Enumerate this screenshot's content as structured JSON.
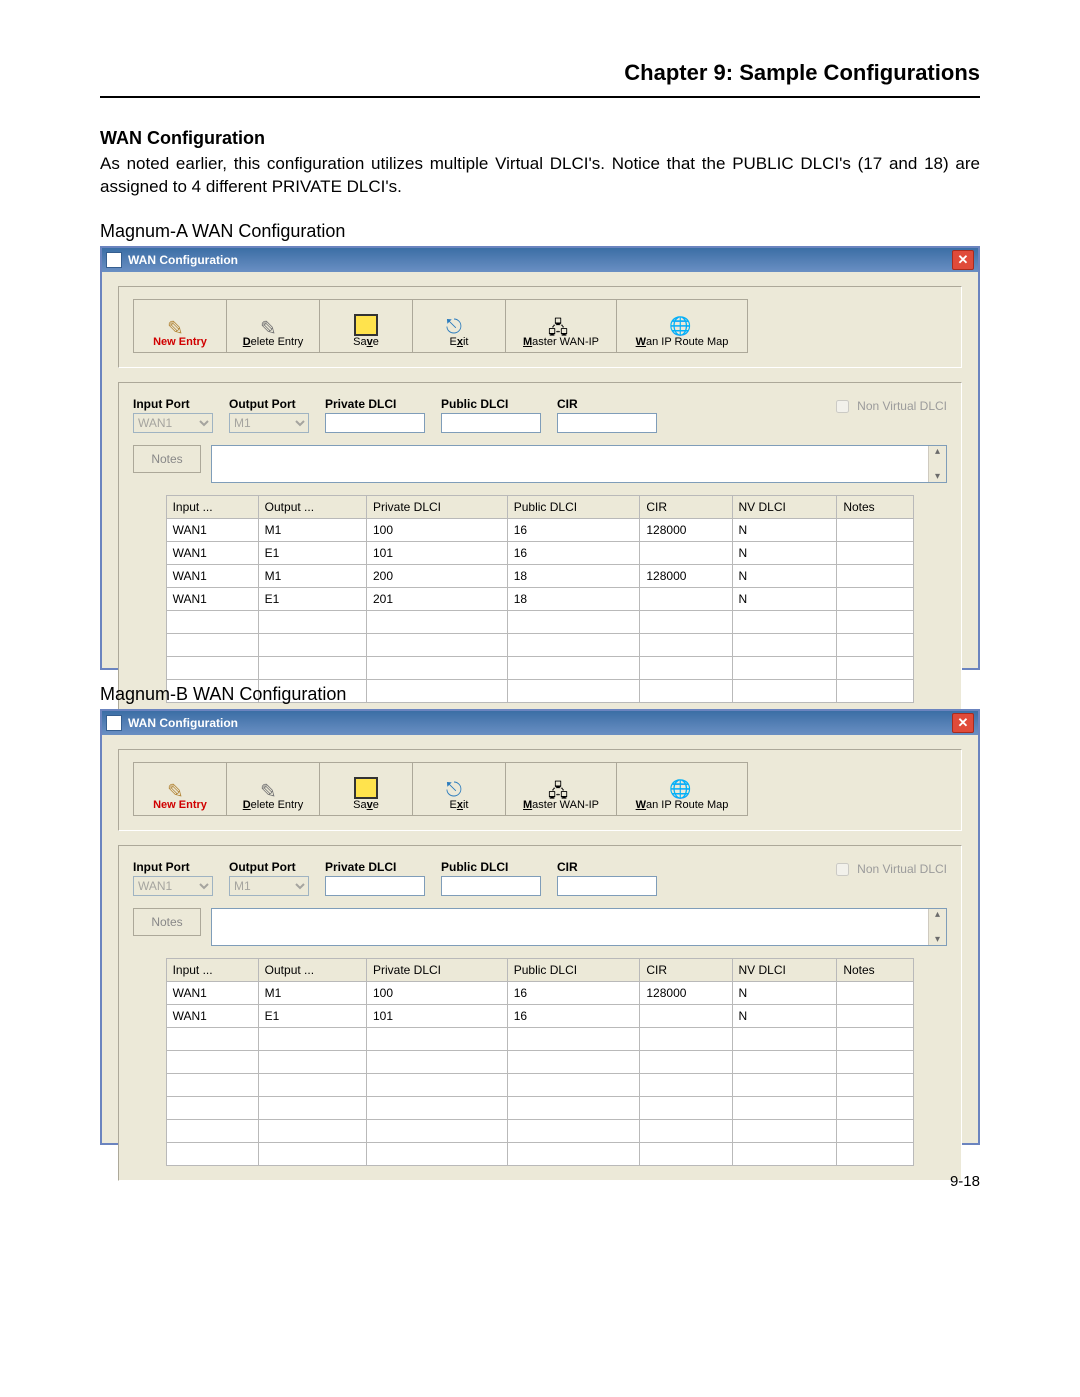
{
  "doc": {
    "chapter": "Chapter 9: Sample Configurations",
    "section": "WAN Configuration",
    "paragraph": "As noted earlier, this configuration utilizes multiple Virtual DLCI's.  Notice that the PUBLIC DLCI's (17 and 18) are assigned to 4 different PRIVATE DLCI's.",
    "labelA": "Magnum-A WAN Configuration",
    "labelB": "Magnum-B WAN Configuration",
    "pagenum": "9-18"
  },
  "win": {
    "title": "WAN Configuration",
    "toolbar": {
      "newentry": "New Entry",
      "deleteentry": "Delete Entry",
      "save": "Save",
      "exit": "Exit",
      "master": "Master WAN-IP",
      "routemap": "Wan IP Route Map"
    },
    "labels": {
      "inputport": "Input Port",
      "outputport": "Output Port",
      "privdlci": "Private DLCI",
      "pubdlci": "Public DLCI",
      "cir": "CIR",
      "nvdlci": "Non Virtual DLCI",
      "notes": "Notes"
    },
    "defaults": {
      "inport": "WAN1",
      "outport": "M1"
    },
    "cols": [
      "Input ...",
      "Output ...",
      "Private DLCI",
      "Public DLCI",
      "CIR",
      "NV DLCI",
      "Notes"
    ]
  },
  "tableA": [
    {
      "in": "WAN1",
      "out": "M1",
      "priv": "100",
      "pub": "16",
      "cir": "128000",
      "nv": "N",
      "notes": ""
    },
    {
      "in": "WAN1",
      "out": "E1",
      "priv": "101",
      "pub": "16",
      "cir": "",
      "nv": "N",
      "notes": ""
    },
    {
      "in": "WAN1",
      "out": "M1",
      "priv": "200",
      "pub": "18",
      "cir": "128000",
      "nv": "N",
      "notes": ""
    },
    {
      "in": "WAN1",
      "out": "E1",
      "priv": "201",
      "pub": "18",
      "cir": "",
      "nv": "N",
      "notes": ""
    }
  ],
  "tableB": [
    {
      "in": "WAN1",
      "out": "M1",
      "priv": "100",
      "pub": "16",
      "cir": "128000",
      "nv": "N",
      "notes": ""
    },
    {
      "in": "WAN1",
      "out": "E1",
      "priv": "101",
      "pub": "16",
      "cir": "",
      "nv": "N",
      "notes": ""
    }
  ]
}
